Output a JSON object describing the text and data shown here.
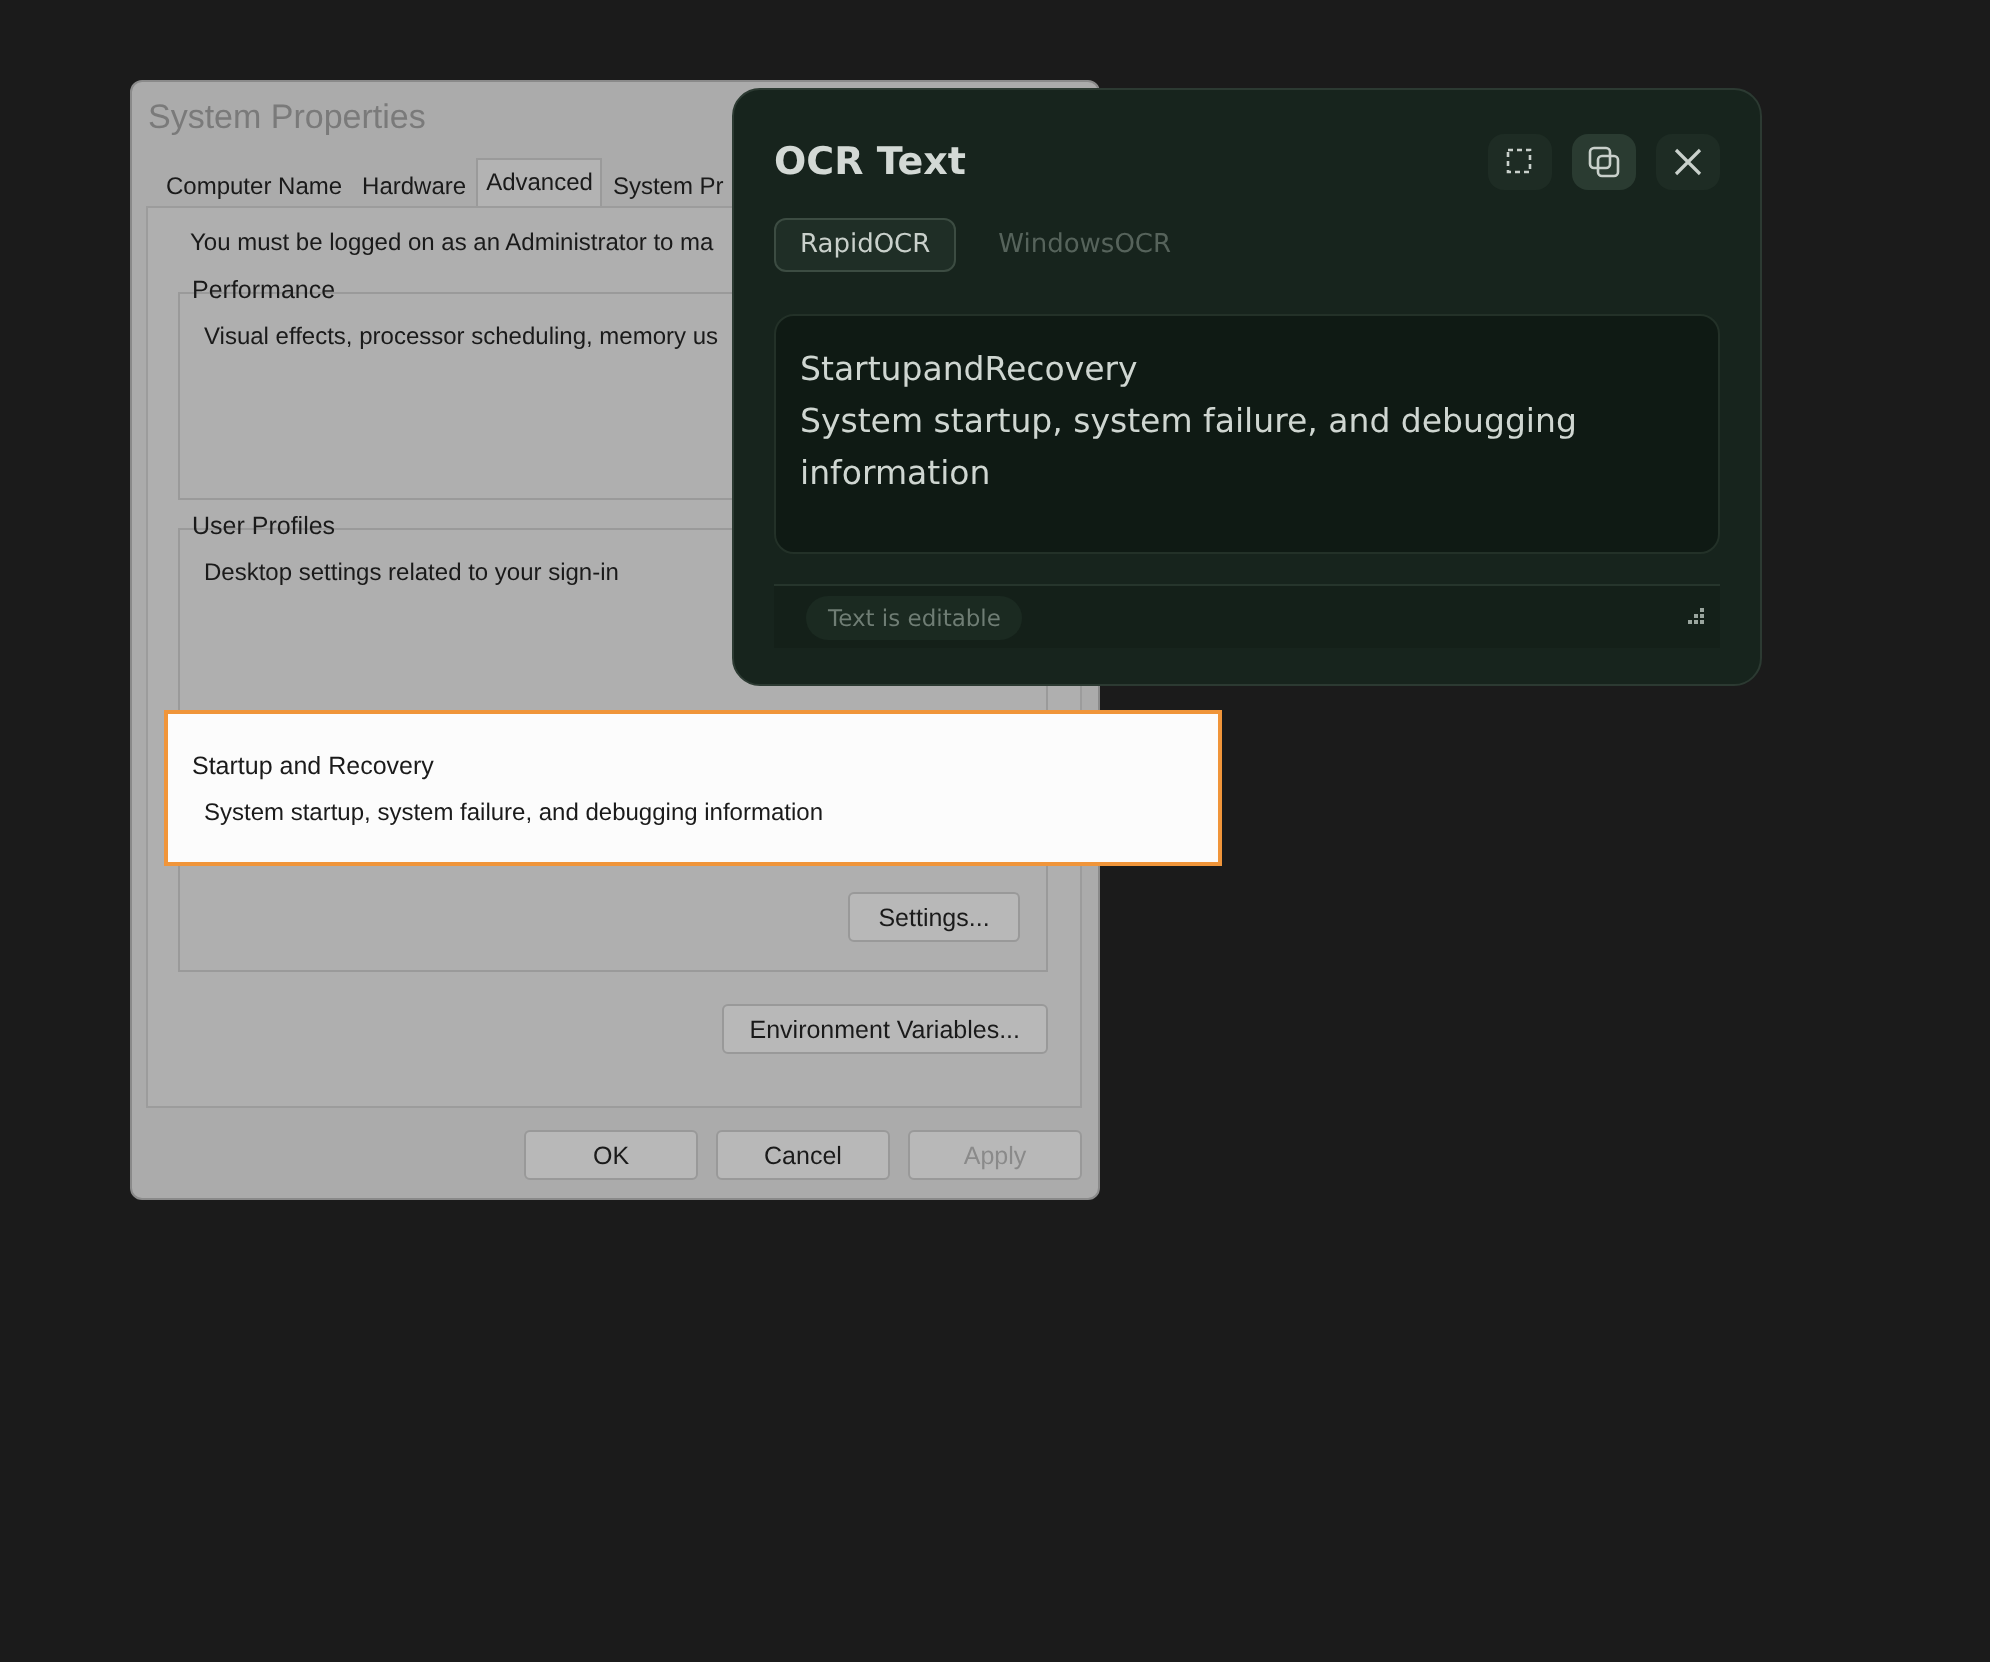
{
  "dialog": {
    "title": "System Properties",
    "tabs": [
      {
        "label": "Computer Name",
        "selected": false
      },
      {
        "label": "Hardware",
        "selected": false
      },
      {
        "label": "Advanced",
        "selected": true
      },
      {
        "label": "System Pr",
        "selected": false
      }
    ],
    "notice": "You must be logged on as an Administrator to ma",
    "groups": [
      {
        "title": "Performance",
        "description": "Visual effects, processor scheduling, memory us",
        "highlighted": false
      },
      {
        "title": "User Profiles",
        "description": "Desktop settings related to your sign-in",
        "highlighted": false
      },
      {
        "title": "Startup and Recovery",
        "description": "System startup, system failure, and debugging information",
        "button": "Settings...",
        "highlighted": true
      }
    ],
    "env_button": "Environment Variables...",
    "buttons": [
      {
        "label": "OK",
        "disabled": false
      },
      {
        "label": "Cancel",
        "disabled": false
      },
      {
        "label": "Apply",
        "disabled": true
      }
    ]
  },
  "ocr_panel": {
    "title": "OCR Text",
    "tabs": [
      {
        "label": "RapidOCR",
        "selected": true
      },
      {
        "label": "WindowsOCR",
        "selected": false
      }
    ],
    "lines": [
      "StartupandRecovery",
      "System startup, system failure, and debugging information"
    ],
    "status": "Text is editable"
  }
}
